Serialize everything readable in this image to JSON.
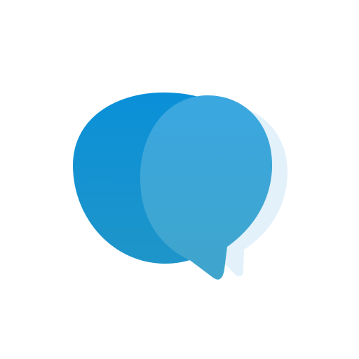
{
  "icon": {
    "name": "chat-bubble-icon",
    "colors": {
      "background": "#ffffff",
      "back_bubble_top": "#0a90d8",
      "back_bubble_bottom": "#1f95c9",
      "front_bubble_top": "#3aa7e0",
      "front_bubble_bottom": "#40a5cc",
      "shadow": "#e3f1fb"
    }
  }
}
